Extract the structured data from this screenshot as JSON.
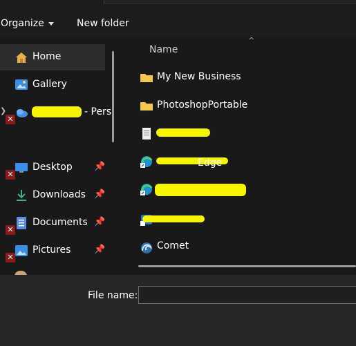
{
  "toolbar": {
    "organize_label": "Organize",
    "new_folder_label": "New folder"
  },
  "nav": {
    "items": [
      {
        "label": "Home",
        "icon": "home-icon",
        "pinned": false
      },
      {
        "label": "Gallery",
        "icon": "gallery-icon",
        "pinned": false
      },
      {
        "label": "- Pers",
        "icon": "onedrive-icon",
        "pinned": false,
        "redacted_prefix": true
      },
      {
        "label": "Desktop",
        "icon": "desktop-icon",
        "pinned": true
      },
      {
        "label": "Downloads",
        "icon": "downloads-icon",
        "pinned": true
      },
      {
        "label": "Documents",
        "icon": "documents-icon",
        "pinned": true
      },
      {
        "label": "Pictures",
        "icon": "pictures-icon",
        "pinned": true
      }
    ]
  },
  "files": {
    "column_name": "Name",
    "items": [
      {
        "label": "My New Business",
        "icon": "folder-icon"
      },
      {
        "label": "PhotoshopPortable",
        "icon": "folder-icon"
      },
      {
        "label": "",
        "icon": "text-file-icon",
        "redacted": true
      },
      {
        "label": "Edge",
        "icon": "edge-shortcut-icon",
        "redacted": true
      },
      {
        "label": "",
        "icon": "edge-shortcut-icon",
        "redacted": true
      },
      {
        "label": "",
        "icon": "app-shortcut-icon",
        "redacted": true
      },
      {
        "label": "Comet",
        "icon": "comet-icon"
      }
    ]
  },
  "footer": {
    "file_name_label": "File name:",
    "file_name_value": ""
  },
  "colors": {
    "background": "#191919",
    "selected": "#2d2d2d",
    "folder": "#f2c94c",
    "error": "#8b1a1a",
    "redaction": "#f5f500"
  }
}
